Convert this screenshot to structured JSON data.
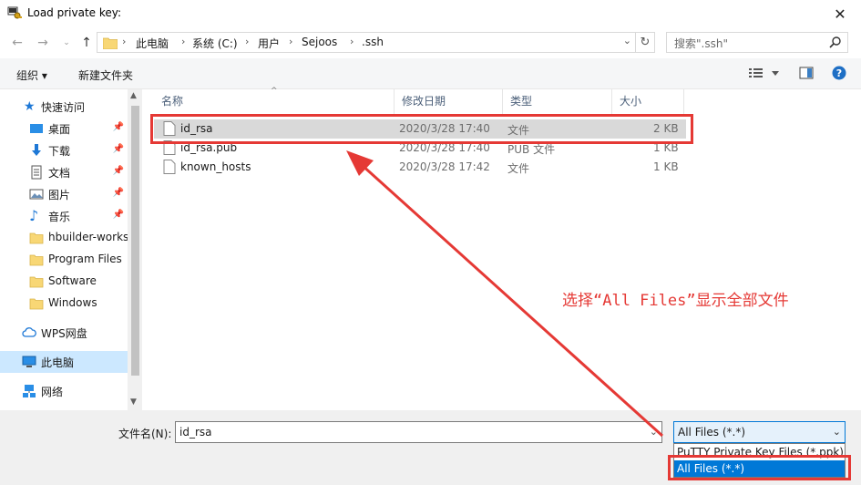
{
  "window": {
    "title": "Load private key:",
    "close_glyph": "✕"
  },
  "address": {
    "crumbs": [
      "此电脑",
      "系统 (C:)",
      "用户",
      "Sejoos",
      ".ssh"
    ],
    "search_placeholder": "搜索\".ssh\""
  },
  "toolbar": {
    "organize": "组织 ▾",
    "new_folder": "新建文件夹"
  },
  "sidebar": {
    "items": [
      {
        "label": "快速访问",
        "icon": "star-icon"
      },
      {
        "label": "桌面",
        "icon": "desktop-icon",
        "pinned": true
      },
      {
        "label": "下载",
        "icon": "download-icon",
        "pinned": true
      },
      {
        "label": "文档",
        "icon": "document-icon",
        "pinned": true
      },
      {
        "label": "图片",
        "icon": "picture-icon",
        "pinned": true
      },
      {
        "label": "音乐",
        "icon": "music-icon",
        "pinned": true
      },
      {
        "label": "hbuilder-works",
        "icon": "folder-icon"
      },
      {
        "label": "Program Files",
        "icon": "folder-icon"
      },
      {
        "label": "Software",
        "icon": "folder-icon"
      },
      {
        "label": "Windows",
        "icon": "folder-icon"
      },
      {
        "label": "WPS网盘",
        "icon": "cloud-icon"
      },
      {
        "label": "此电脑",
        "icon": "computer-icon",
        "selected": true
      },
      {
        "label": "网络",
        "icon": "network-icon"
      }
    ]
  },
  "columns": {
    "name": "名称",
    "modified": "修改日期",
    "type": "类型",
    "size": "大小"
  },
  "files": [
    {
      "name": "id_rsa",
      "modified": "2020/3/28 17:40",
      "type": "文件",
      "size": "2 KB",
      "selected": true
    },
    {
      "name": "id_rsa.pub",
      "modified": "2020/3/28 17:40",
      "type": "PUB 文件",
      "size": "1 KB"
    },
    {
      "name": "known_hosts",
      "modified": "2020/3/28 17:42",
      "type": "文件",
      "size": "1 KB"
    }
  ],
  "bottom": {
    "filename_label": "文件名(N):",
    "filename_value": "id_rsa",
    "filetype_value": "All Files (*.*)",
    "filetype_options": [
      "PuTTY Private Key Files (*.ppk)",
      "All Files (*.*)"
    ]
  },
  "annotation": {
    "text": "选择“All Files”显示全部文件",
    "color": "#e53935"
  },
  "colors": {
    "accent": "#0078d7",
    "selection": "#cce8ff",
    "annotation": "#e53935"
  }
}
